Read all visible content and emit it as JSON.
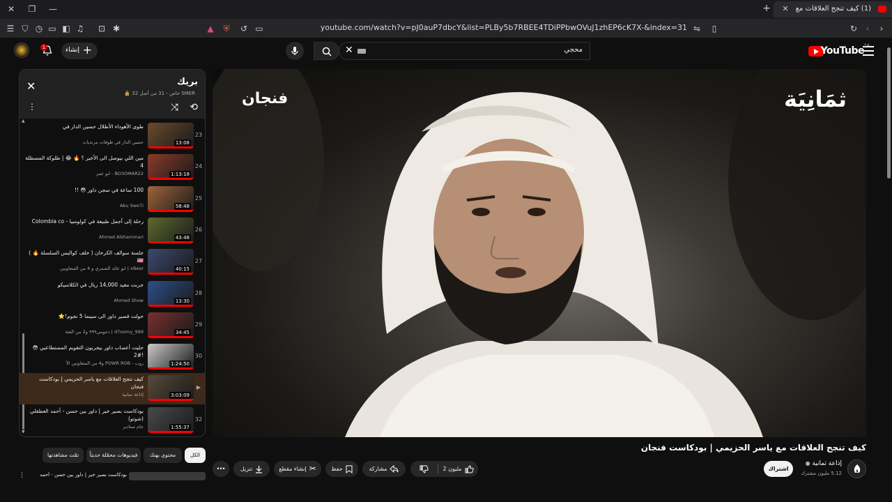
{
  "browser": {
    "tab_title": "(1) كيف تنجح العلاقات مع ياسر",
    "url": "youtube.com/watch?v=pJ0auP7dbcY&list=PLBy5b7RBEE4TDiPPbwOVuJ1zhEP6cK7X-&index=31"
  },
  "masthead": {
    "logo_text": "YouTube",
    "region": "SA",
    "search_value": "محجي",
    "create_label": "إنشاء",
    "notification_count": "1"
  },
  "player": {
    "brand_left": "فنجان",
    "brand_right": "ثمَانِيَة"
  },
  "video": {
    "title": "كيف تنجح العلاقات مع ياسر الحزيمي | بودكاست فنجان",
    "channel": "إذاعة ثمانية",
    "subscribers": "5.12 مليون مشترك",
    "subscribe_label": "اشتراك",
    "like_count": "2 مليون",
    "share_label": "مشاركة",
    "save_label": "حفظ",
    "clip_label": "إنشاء مقطع",
    "download_label": "تنزيل"
  },
  "playlist": {
    "title": "بريك",
    "subtitle": "SMER خاص - 31 من أصل 32",
    "items": [
      {
        "index": "23",
        "title": "طوى الأهوداء الأطلال حسين الدار في",
        "channel": "حسين الدار في طوقات مرنديات",
        "duration": "13:08",
        "thumb": "#6b4a2d"
      },
      {
        "index": "24",
        "title": "مين اللي بيوصل الى الأخير ؟ 🔥 😂 | طلوكة المسطلة 4",
        "channel": "BO3OMAR22 - ابو عمر",
        "duration": "1:13:18",
        "thumb": "#8a3b2a"
      },
      {
        "index": "25",
        "title": "100 ساعة في سجن داور 😳 !!",
        "channel": "Abu Swe7i",
        "duration": "58:48",
        "thumb": "#a0643a"
      },
      {
        "index": "26",
        "title": "رحلة إلى أجمل طبيعة في كولومبيا - Colombia co",
        "channel": "Ahmed Alshammari",
        "duration": "43:48",
        "thumb": "#5d6a2e"
      },
      {
        "index": "27",
        "title": "جلسة سوالف الكرخان ( خلف كواليس السلسلة 🔥 ) 🇺🇸",
        "channel": "xBear | ابو عائد الشمري و 4 من المتعاونين",
        "duration": "40:15",
        "thumb": "#3c4a6e"
      },
      {
        "index": "28",
        "title": "جربت مفيد 14,000 ريال في الكلاسيكو",
        "channel": "Ahmed Show",
        "duration": "13:30",
        "thumb": "#2e4f8a"
      },
      {
        "index": "29",
        "title": "حولت قصير داور الى سينما 5 نجوم!⭐",
        "channel": "d7oomy_999 | دحومي٩٩٩ و2 من الفئة",
        "duration": "34:45",
        "thumb": "#7a2f2f"
      },
      {
        "index": "30",
        "title": "حليت أعصاب داور بيجربون التقويم المستطاعيي 😳 !#2",
        "channel": "روب - POWR ROB و4 من المتعاونين الآ",
        "duration": "1:24:50",
        "thumb": "#c9c9c9"
      },
      {
        "index": "",
        "title": "كيف تنجح العلاقات مع ياسر الحزيمي | بودكاست فنجان",
        "channel": "إذاعة ثمانية",
        "duration": "3:03:09",
        "thumb": "#5a4a3a"
      },
      {
        "index": "32",
        "title": "بودكاست بصير خير | داور بين حسن - أحمد العطفلي (شوتو)",
        "channel": "جام ستادير",
        "duration": "1:55:37",
        "thumb": "#4a4a4a"
      }
    ]
  },
  "chips": {
    "all": "الكل",
    "from_channel": "محتوى بهنك",
    "recent": "فيديوهات محمّلة حديثاً",
    "watched": "تمّت مشاهدتها"
  },
  "next_item_title": "بودكاست بصير خير | داور بين حسن - أحمد"
}
